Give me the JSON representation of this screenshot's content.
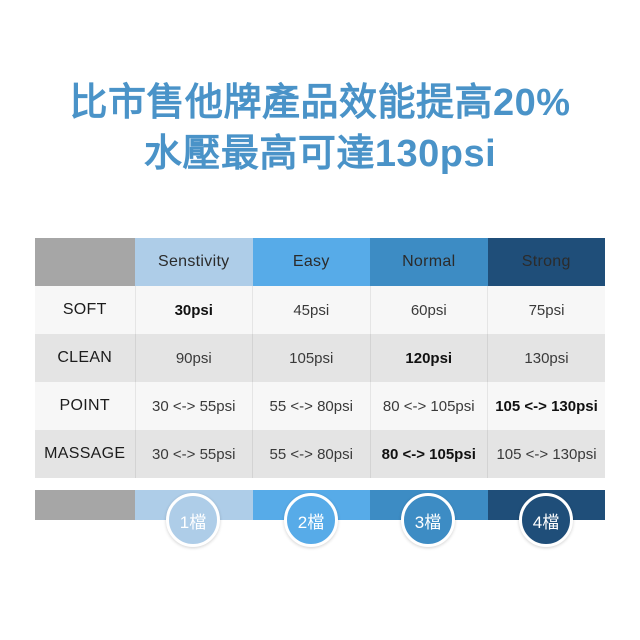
{
  "headline": {
    "line1": "比市售他牌產品效能提高20%",
    "line2": "水壓最高可達130psi",
    "color": "#4a93c8"
  },
  "table": {
    "corner_label": "",
    "columns": [
      {
        "key": "sensitivity",
        "label": "Senstivity",
        "color": "#aecde8"
      },
      {
        "key": "easy",
        "label": "Easy",
        "color": "#57abe8"
      },
      {
        "key": "normal",
        "label": "Normal",
        "color": "#3d8cc4"
      },
      {
        "key": "strong",
        "label": "Strong",
        "color": "#1f4e79"
      }
    ],
    "corner_color": "#a6a6a6",
    "rows": [
      {
        "label": "SOFT",
        "cells": [
          {
            "text": "30psi",
            "bold": true
          },
          {
            "text": "45psi",
            "bold": false
          },
          {
            "text": "60psi",
            "bold": false
          },
          {
            "text": "75psi",
            "bold": false
          }
        ]
      },
      {
        "label": "CLEAN",
        "cells": [
          {
            "text": "90psi",
            "bold": false
          },
          {
            "text": "105psi",
            "bold": false
          },
          {
            "text": "120psi",
            "bold": true
          },
          {
            "text": "130psi",
            "bold": false
          }
        ]
      },
      {
        "label": "POINT",
        "cells": [
          {
            "text": "30 <-> 55psi",
            "bold": false
          },
          {
            "text": "55 <-> 80psi",
            "bold": false
          },
          {
            "text": "80 <-> 105psi",
            "bold": false
          },
          {
            "text": "105 <-> 130psi",
            "bold": true
          }
        ]
      },
      {
        "label": "MASSAGE",
        "cells": [
          {
            "text": "30 <-> 55psi",
            "bold": false
          },
          {
            "text": "55 <-> 80psi",
            "bold": false
          },
          {
            "text": "80 <-> 105psi",
            "bold": true
          },
          {
            "text": "105 <-> 130psi",
            "bold": false
          }
        ]
      }
    ]
  },
  "badges": [
    {
      "label": "1檔",
      "color": "#aecde8"
    },
    {
      "label": "2檔",
      "color": "#57abe8"
    },
    {
      "label": "3檔",
      "color": "#3d8cc4"
    },
    {
      "label": "4檔",
      "color": "#1f4e79"
    }
  ]
}
